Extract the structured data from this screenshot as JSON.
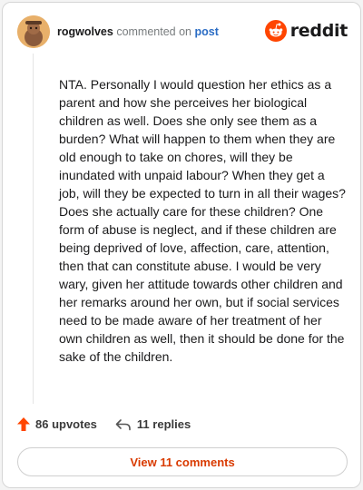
{
  "comment": {
    "username": "rogwolves",
    "action_text": "commented on",
    "post_link_label": "post",
    "body": "NTA. Personally I would question her ethics as a parent and how she perceives her biological children as well. Does she only see them as a burden? What will happen to them when they are old enough to take on chores, will they be inundated with unpaid labour? When they get a job, will they be expected to turn in all their wages? Does she actually care for these children? One form of abuse is neglect, and if these children are being deprived of love, affection, care, attention, then that can constitute abuse. I would be very wary, given her attitude towards other children and her remarks around her own, but if social services need to be made aware of her treatment of her own children as well, then it should be done for the sake of the children."
  },
  "brand": {
    "wordmark": "reddit",
    "icon": "reddit-snoo-icon",
    "color": "#ff4500"
  },
  "stats": {
    "upvotes_label": "86 upvotes",
    "upvote_icon": "upvote-arrow-icon",
    "upvote_color": "#ff4500",
    "replies_label": "11 replies",
    "reply_icon": "reply-arrow-icon"
  },
  "actions": {
    "view_comments_label": "View 11 comments",
    "view_comments_color": "#d93a00"
  }
}
